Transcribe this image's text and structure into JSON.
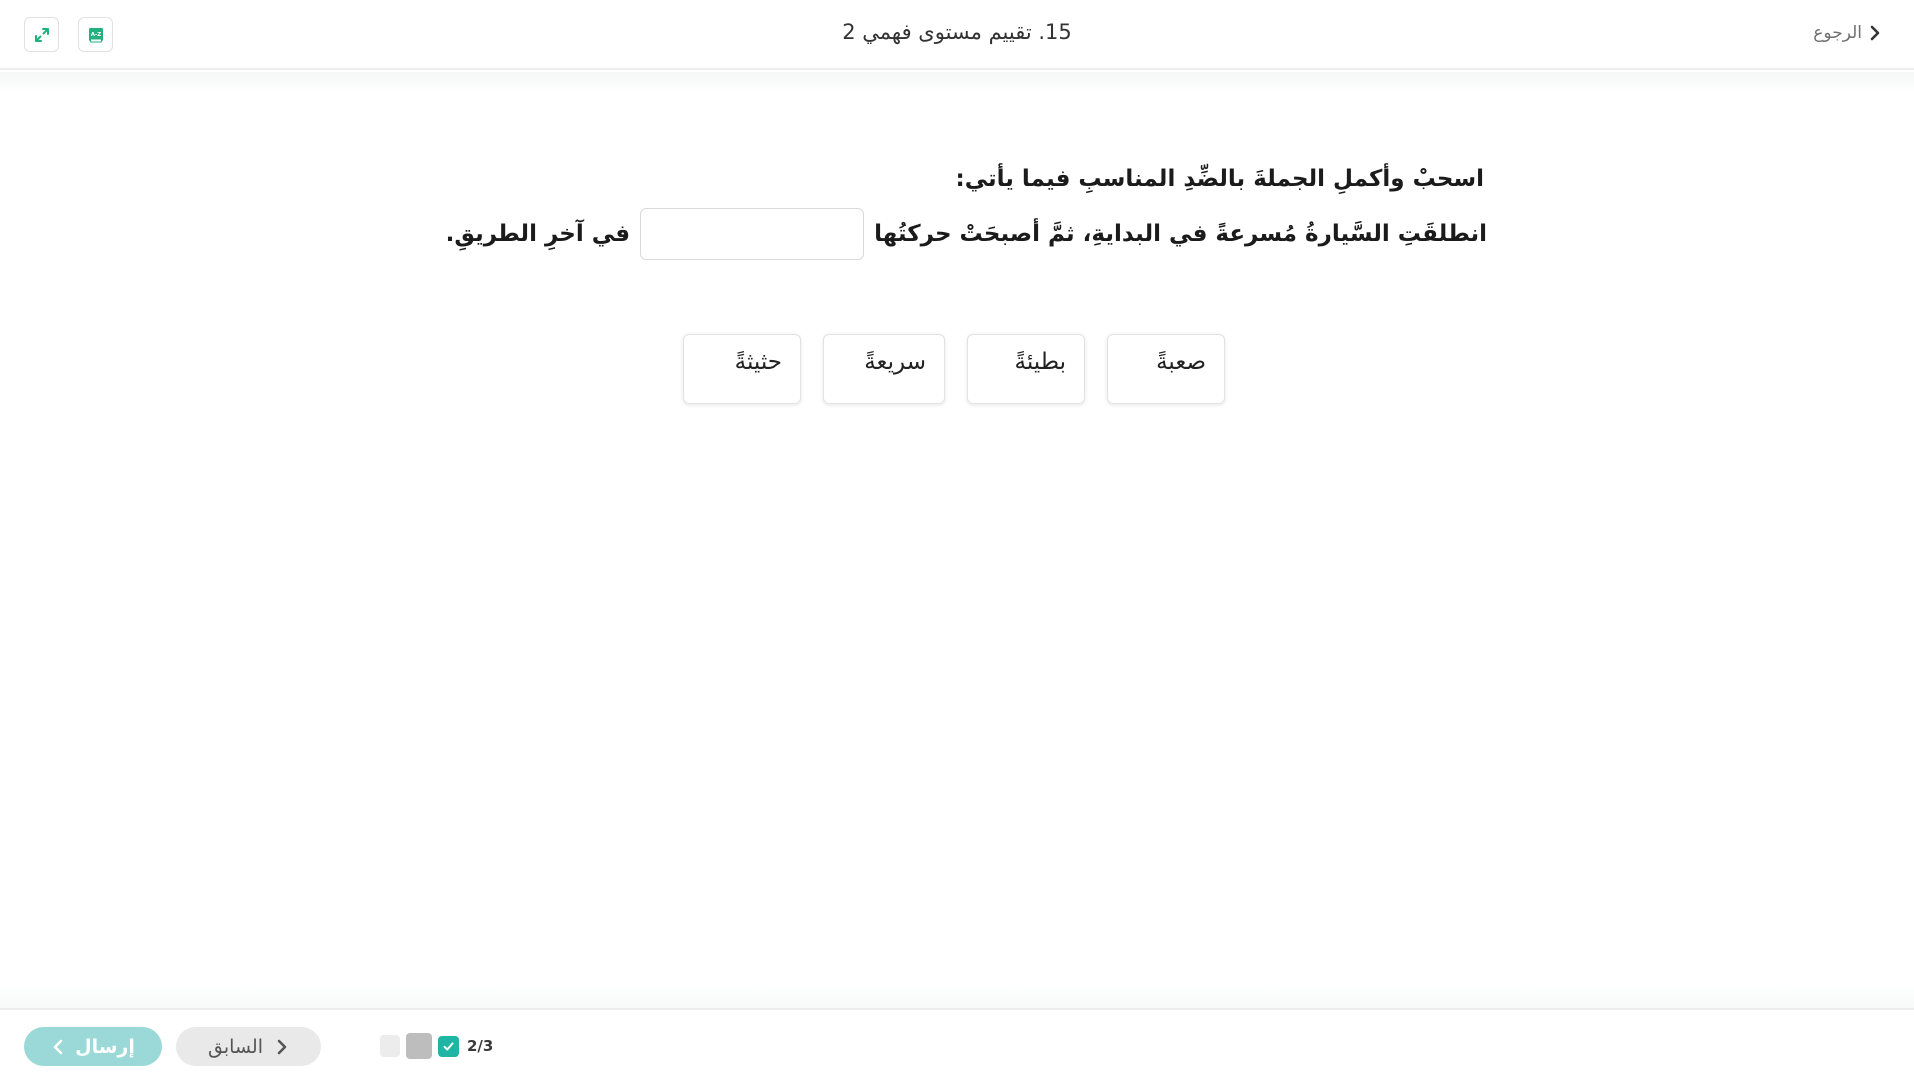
{
  "header": {
    "title": "15. تقييم مستوى فهمي 2",
    "back_label": "الرجوع",
    "expand_icon": "expand-arrows-icon",
    "book_icon": "dictionary-book-icon",
    "accent_color": "#22b07d"
  },
  "question": {
    "instruction": "اسحبْ وأكملِ الجملةَ بالضِّدِ المناسبِ فيما يأتي:",
    "sentence_before": "انطلقَتِ السَّيارةُ مُسرعةً في البدايةِ، ثمَّ أصبحَتْ حركتُها",
    "sentence_after": "في آخرِ الطريقِ.",
    "blank_value": ""
  },
  "options": [
    {
      "label": "صعبةً"
    },
    {
      "label": "بطيئةً"
    },
    {
      "label": "سريعةً"
    },
    {
      "label": "حثيثةً"
    }
  ],
  "footer": {
    "send_label": "إرسال",
    "prev_label": "السابق",
    "progress_text": "2/3",
    "send_color": "#9ad9d7",
    "done_color": "#1fb5a5"
  }
}
